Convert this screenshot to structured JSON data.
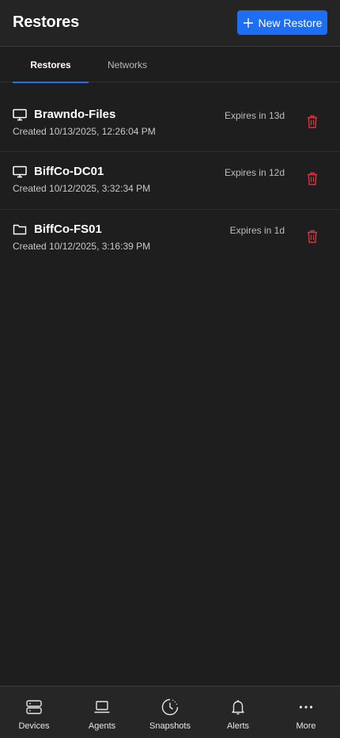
{
  "header": {
    "title": "Restores",
    "new_button_label": "New Restore"
  },
  "tabs": [
    {
      "label": "Restores",
      "active": true
    },
    {
      "label": "Networks",
      "active": false
    }
  ],
  "restores": [
    {
      "name": "Brawndo-Files",
      "icon": "monitor-icon",
      "created": "Created 10/13/2025, 12:26:04 PM",
      "expires": "Expires in 13d"
    },
    {
      "name": "BiffCo-DC01",
      "icon": "monitor-icon",
      "created": "Created 10/12/2025, 3:32:34 PM",
      "expires": "Expires in 12d"
    },
    {
      "name": "BiffCo-FS01",
      "icon": "folder-icon",
      "created": "Created 10/12/2025, 3:16:39 PM",
      "expires": "Expires in 1d"
    }
  ],
  "bottom_nav": [
    {
      "label": "Devices",
      "icon": "devices-icon"
    },
    {
      "label": "Agents",
      "icon": "laptop-icon"
    },
    {
      "label": "Snapshots",
      "icon": "clock-icon"
    },
    {
      "label": "Alerts",
      "icon": "bell-icon"
    },
    {
      "label": "More",
      "icon": "more-icon"
    }
  ],
  "colors": {
    "accent": "#1e6ef4",
    "danger": "#d9363e",
    "background": "#1e1e1e"
  }
}
